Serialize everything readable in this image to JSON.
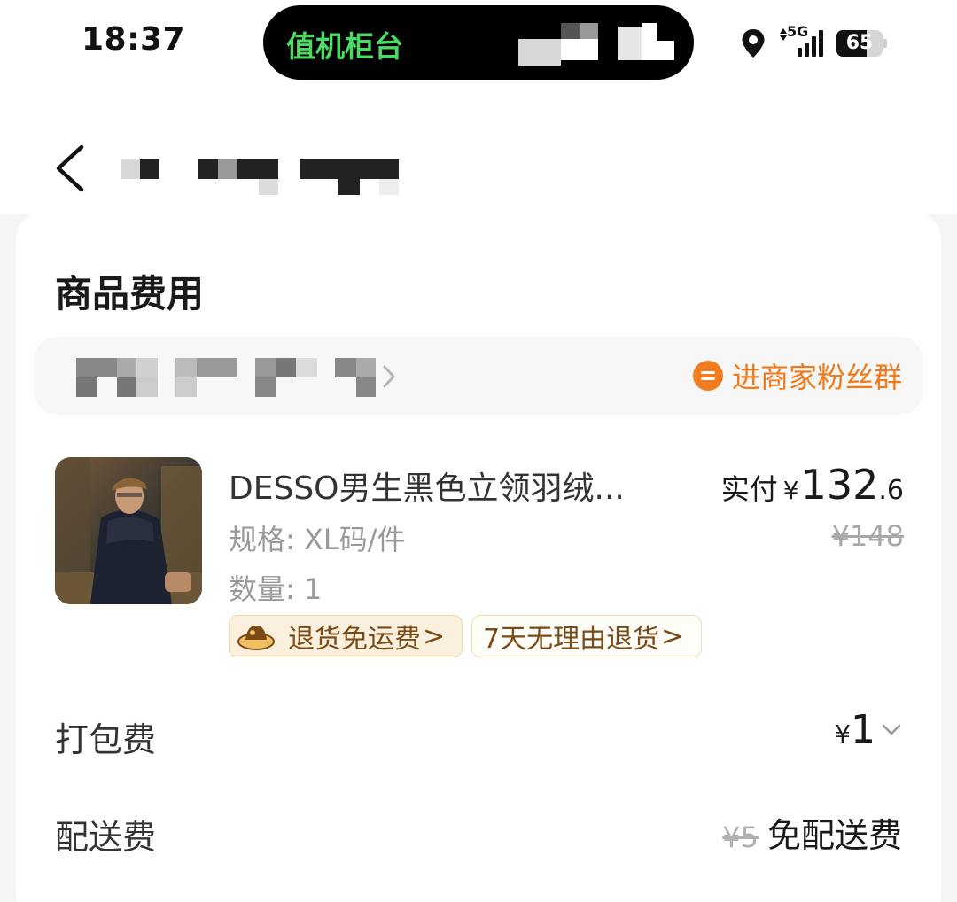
{
  "status_bar": {
    "time": "18:37",
    "island_text": "值机柜台",
    "network": "5G",
    "battery": "65",
    "battery_level": 0.65
  },
  "nav": {
    "back_icon": "chevron-left-icon"
  },
  "section": {
    "title": "商品费用"
  },
  "store": {
    "fan_group_label": "进商家粉丝群",
    "fan_group_icon": "chat-bubble-icon"
  },
  "product": {
    "name": "DESSO男生黑色立领羽绒...",
    "spec": "规格: XL码/件",
    "quantity": "数量: 1",
    "paid_label": "实付",
    "paid_symbol": "¥",
    "paid_integer": "132",
    "paid_decimal": ".6",
    "original_price": "¥148",
    "tags": [
      {
        "label": "退货免运费",
        "arrow": ">"
      },
      {
        "label": "7天无理由退货",
        "arrow": ">"
      }
    ]
  },
  "fees": {
    "packing_label": "打包费",
    "packing_symbol": "¥",
    "packing_amount": "1",
    "delivery_label": "配送费",
    "delivery_original": "¥5",
    "delivery_free": "免配送费"
  },
  "colors": {
    "accent_orange": "#f07a1a",
    "island_green": "#4cd964",
    "tag_brown": "#7a4b17"
  }
}
